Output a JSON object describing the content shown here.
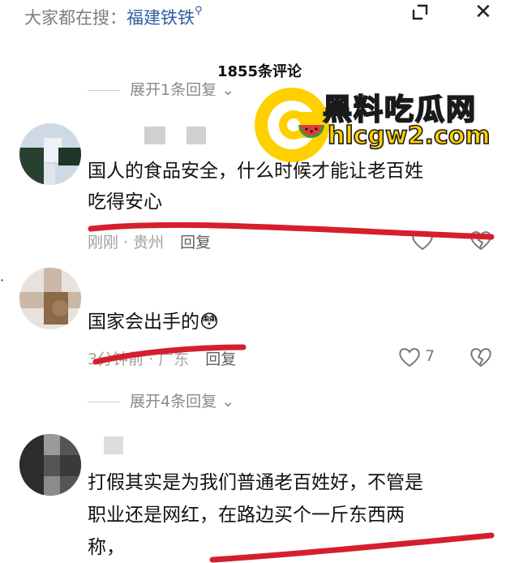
{
  "header": {
    "search_prefix": "大家都在搜：",
    "search_keyword": "福建铁铁",
    "search_icon": "search-icon",
    "minimize_icon": "minimize-icon",
    "close_glyph": "✕"
  },
  "comments_count": "1855条评论",
  "top_reply_toggle": "展开1条回复",
  "watermark": {
    "title": "黑料吃瓜网",
    "url": "hlcgw2.com"
  },
  "comments": [
    {
      "text_line1": "国人的食品安全，什么时候才能让老百姓",
      "text_line2": "吃得安心",
      "time_location": "刚刚 · 贵州",
      "reply_label": "回复"
    },
    {
      "text": "国家会出手的😳",
      "time_location": "3分钟前 · 广东",
      "reply_label": "回复",
      "like_count": "7",
      "expand_replies": "展开4条回复"
    },
    {
      "text_line1": "打假其实是为我们普通老百姓好，不管是",
      "text_line2": "职业还是网红，在路边买个一斤东西两",
      "text_line3": "称，"
    }
  ],
  "colors": {
    "accent": "#2f5f9e",
    "red_marker": "#d61f2c",
    "watermark_yellow": "#ffd000"
  }
}
